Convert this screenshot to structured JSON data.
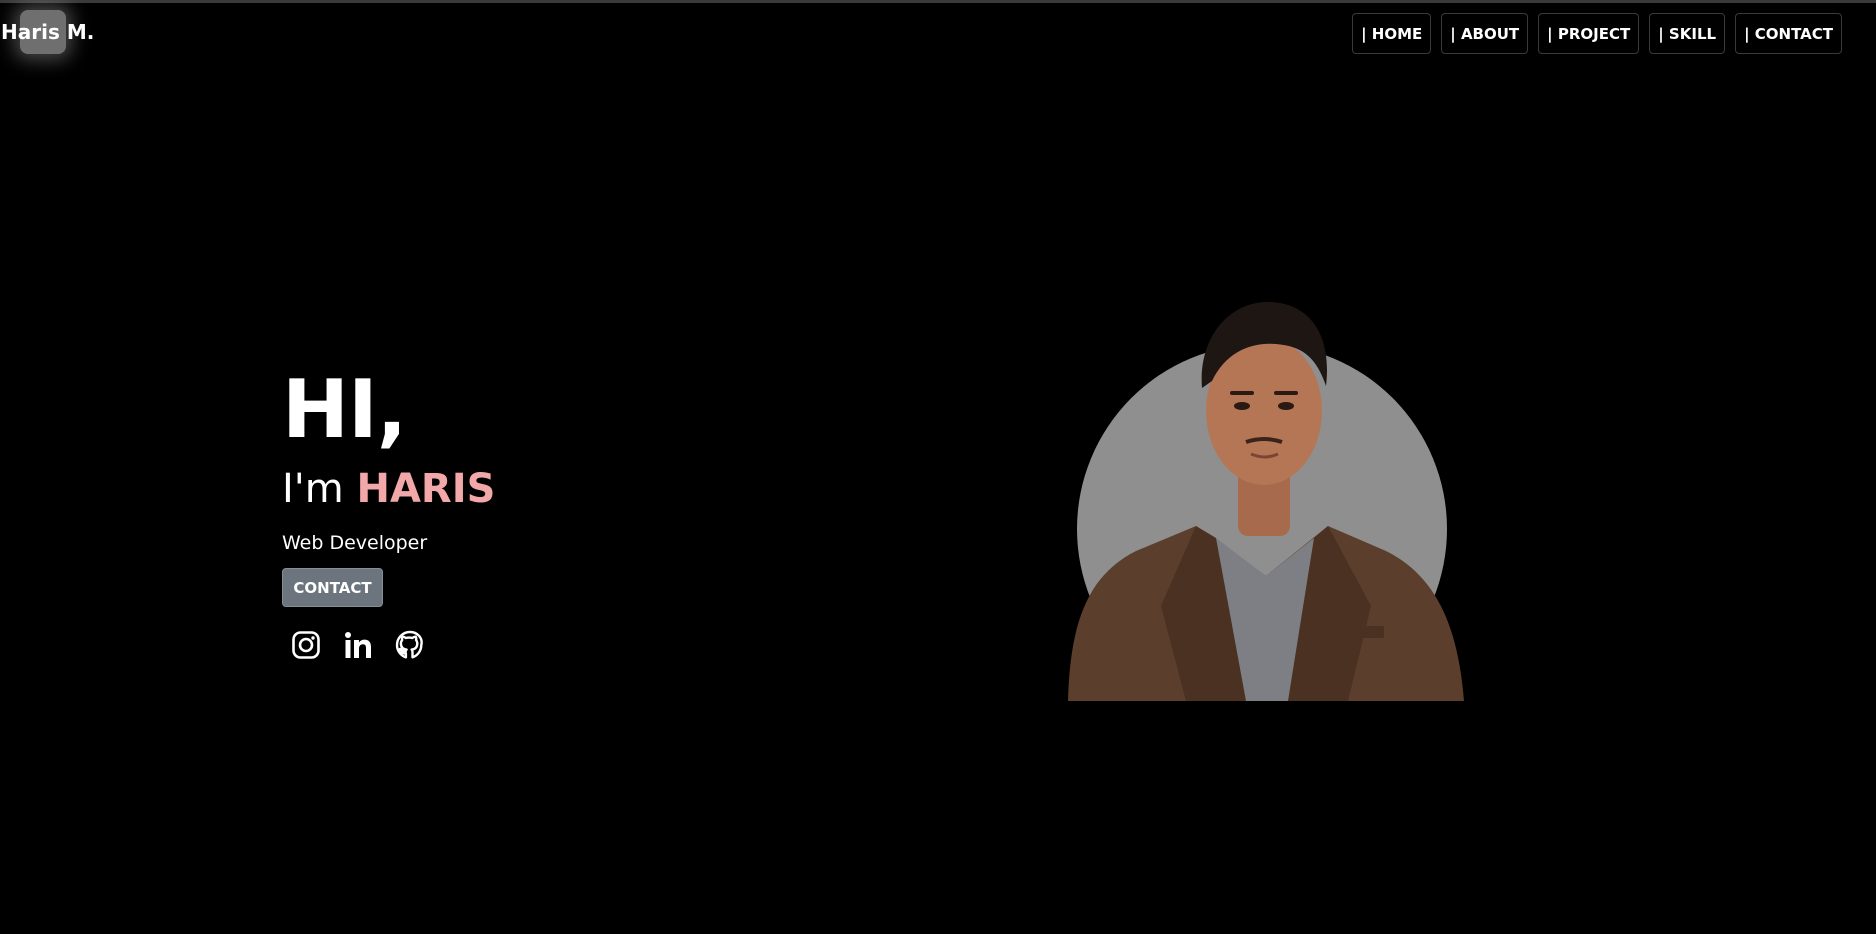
{
  "header": {
    "logo": "Haris M.",
    "nav": [
      {
        "label": "| HOME"
      },
      {
        "label": "| ABOUT"
      },
      {
        "label": "| PROJECT"
      },
      {
        "label": "| SKILL"
      },
      {
        "label": "| CONTACT"
      }
    ]
  },
  "hero": {
    "greeting": "HI,",
    "intro_prefix": "I'm ",
    "name": "HARIS",
    "role": "Web Developer",
    "contact_button": "CONTACT",
    "socials": [
      {
        "icon": "instagram-icon"
      },
      {
        "icon": "linkedin-icon"
      },
      {
        "icon": "github-icon"
      }
    ]
  },
  "colors": {
    "background": "#000000",
    "name_accent": "#f2a8a8",
    "button_bg": "#6c757d",
    "portrait_circle": "#8f8f8f",
    "jacket": "#5b3e2b"
  }
}
